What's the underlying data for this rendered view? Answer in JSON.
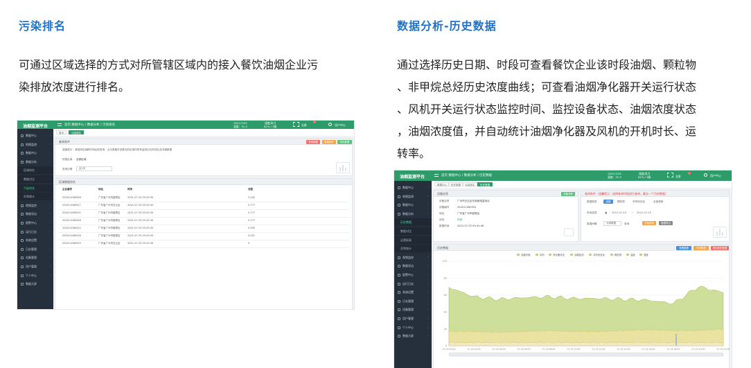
{
  "left": {
    "heading": "污染排名",
    "description_lines": [
      "可通过区域选择的方式对所管辖区域内的接入餐饮油烟企业污",
      "染排放浓度进行排名。"
    ],
    "app": {
      "logo": "油烟监测平台",
      "breadcrumb": "首页  数据中心 / 数据分析 / 污染排名",
      "stat1_line1": "2021/7/25",
      "stat1_line2": "温度：31.5",
      "stat2_line1": "湿度/风力",
      "stat2_line2": "62% / 3级",
      "fullscreen_label": "全屏",
      "user_label": "用户中心",
      "tabs": [
        "首页",
        "污染排名"
      ],
      "sidebar": [
        "数据中心",
        "地图监测",
        "数据中心",
        "数据分析",
        "区域排名",
        "数据对比",
        "污染排名",
        "异常统计",
        "视频监控",
        "数据导出",
        "报警中心",
        "运行日志",
        "系统设置",
        "日志管理",
        "设备管理",
        "用户管理",
        "个人中心",
        "数据大屏"
      ],
      "filter_header": "查询条件",
      "hint": "温馨提示：请选择区域和时间后再查询，点击表格可查看当前区域内所有监测点位的排名及详细数据",
      "region_label": "所属区域",
      "region_value": "全部区域",
      "time_label": "查询日期",
      "time_value": "近1天",
      "buttons": [
        "查询数据",
        "重置条件",
        "导出数据"
      ],
      "table_header": "区域数据排名",
      "columns": [
        "企业编号",
        "地址",
        "时间",
        "浓度"
      ],
      "rows": [
        [
          "202011060508",
          "广东省广州市越秀区",
          "2021-07-25 03:43:30",
          "3.102"
        ],
        [
          "202011060527",
          "广东省广州市白云区",
          "2021-07-25 03:43:30",
          "0.777"
        ],
        [
          "202011060531",
          "广东省广州市越秀区",
          "2021-07-25 03:43:30",
          "0.777"
        ],
        [
          "202011060526",
          "广东省广州市越秀区",
          "2021-07-25 03:43:30",
          "0.777"
        ],
        [
          "202011060524",
          "广东省广州市越秀区",
          "2021-07-25 03:43:30",
          "0.595"
        ],
        [
          "202011060518",
          "广东省广州市越秀区",
          "2021-07-25 03:43:30",
          "0.021"
        ],
        [
          "202011060529",
          "广东省广州市白云区",
          "2021-07-25 03:43:30",
          "0"
        ]
      ]
    }
  },
  "right": {
    "heading": "数据分析-历史数据",
    "description_lines": [
      "通过选择历史日期、时段可查看餐饮企业该时段油烟、颗粒物",
      "、非甲烷总烃历史浓度曲线；可查看油烟净化器开关运行状态",
      "、风机开关运行状态监控时间、监控设备状态、油烟浓度状态",
      "，油烟浓度值，并自动统计油烟净化器及风机的开机时长、运",
      "转率。"
    ],
    "app": {
      "logo": "油烟监测平台",
      "breadcrumb": "首页  数据中心 / 数据分析 / 历史数据",
      "stat1_line1": "2021/7/25",
      "stat1_line2": "温度：31.5",
      "stat2_line1": "湿度/风力",
      "stat2_line2": "62% / 3级",
      "fullscreen_label": "全屏",
      "user_label": "用户中心",
      "tabs": [
        "数据中心",
        "历史数据",
        "污染排名",
        "历史数据"
      ],
      "sidebar": [
        "数据中心",
        "地图监测",
        "数据中心",
        "数据分析",
        "历史数据",
        "数据对比",
        "运营报表",
        "异常统计",
        "视频监控",
        "数据导出",
        "报警中心",
        "运行日志",
        "系统设置",
        "日志管理",
        "设备管理",
        "用户管理",
        "个人中心",
        "数据大屏"
      ],
      "info_header": "设备信息",
      "info_button": "设备详情",
      "info_fields": [
        {
          "label": "设备名称",
          "value": "广州市白云区东南食堂监测点"
        },
        {
          "label": "设备编号",
          "value": "202011060522"
        },
        {
          "label": "地址",
          "value": "广东省广州市越秀区"
        },
        {
          "label": "状态",
          "value": "在线"
        },
        {
          "label": "数据时间",
          "value": "2021-07-25 09:41:46"
        }
      ],
      "query_header": "查询条件（温馨提示：选择查询时段进行查询，最长一个月的数据）",
      "query_type_label": "数据类型",
      "query_types": [
        "油烟",
        "颗粒物",
        "非甲烷总烃",
        "全部参数"
      ],
      "date_label": "时间选择",
      "date_from": "2021-07-24",
      "date_to": "2021-07-25",
      "interval_label": "数据间隔",
      "interval_value": "分钟数据",
      "interval_extra": "查询",
      "query_buttons": [
        "开始查询",
        "数据导出"
      ],
      "chart_header": "历史数据",
      "chart_buttons": [
        "查看数据",
        "打印报表",
        "导出历史数据"
      ],
      "legend": [
        "油烟浓度",
        "风机",
        "净化器状态",
        "油烟监测",
        "非甲烷总烃",
        "颗粒物",
        "温度",
        "湿度"
      ]
    },
    "chart_data": {
      "type": "area",
      "x": [
        "07-25 00:00",
        "07-25 02:00",
        "07-25 04:00",
        "07-25 06:00",
        "07-25 08:00",
        "07-25 10:00",
        "07-25 12:00",
        "07-25 14:00",
        "07-25 16:00",
        "07-25 18:00",
        "07-25 20:00",
        "07-25 22:00"
      ],
      "y_ticks": [
        "100",
        "80",
        "60",
        "40",
        "20",
        "0"
      ],
      "series": [
        {
          "values": [
            69,
            58,
            55,
            57,
            58,
            56,
            56,
            55,
            54,
            50,
            70,
            63
          ],
          "color": "#c5d98a"
        },
        {
          "values": [
            17,
            17,
            16,
            17,
            18,
            17,
            17,
            18,
            19,
            18,
            18,
            20
          ],
          "color": "#ede3a2"
        },
        {
          "values": [
            4,
            4,
            4,
            4,
            4,
            4,
            4,
            4,
            4,
            4,
            4,
            4
          ],
          "color": "#f0ead0"
        }
      ],
      "ylim": [
        0,
        100
      ]
    }
  }
}
